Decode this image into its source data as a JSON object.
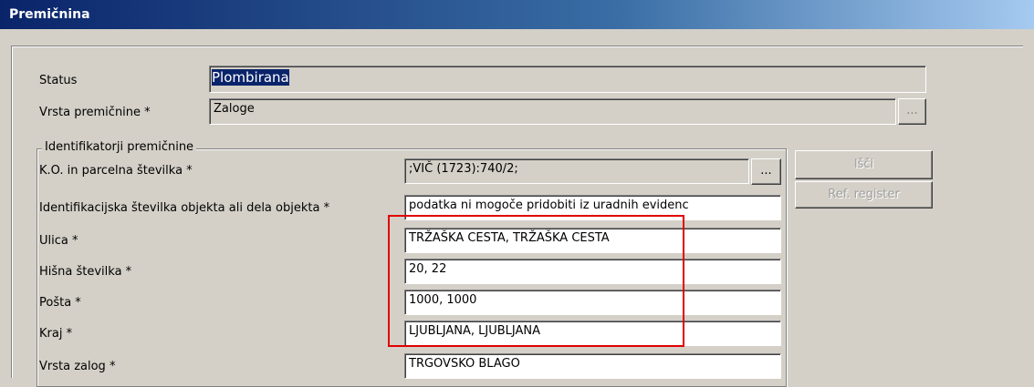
{
  "window": {
    "title": "Premičnina"
  },
  "status": {
    "label": "Status",
    "value": "Plombirana"
  },
  "vrsta": {
    "label": "Vrsta premičnine *",
    "value": "Zaloge",
    "browse": "..."
  },
  "group": {
    "title": "Identifikatorji premičnine",
    "ko": {
      "label": "K.O. in parcelna številka *",
      "value": ";VIČ (1723):740/2;",
      "browse": "..."
    },
    "idobj": {
      "label": "Identifikacijska številka objekta ali dela objekta *",
      "value": "podatka ni mogoče pridobiti iz uradnih evidenc"
    },
    "ulica": {
      "label": "Ulica *",
      "value": "TRŽAŠKA CESTA, TRŽAŠKA CESTA"
    },
    "hisna": {
      "label": "Hišna številka *",
      "value": "20, 22"
    },
    "posta": {
      "label": "Pošta *",
      "value": "1000, 1000"
    },
    "kraj": {
      "label": "Kraj *",
      "value": "LJUBLJANA, LJUBLJANA"
    },
    "zalog": {
      "label": "Vrsta zalog *",
      "value": "TRGOVSKO BLAGO"
    }
  },
  "buttons": {
    "isci": "Išči",
    "ref": "Ref. register"
  },
  "colors": {
    "titlebar": "#0a246a",
    "highlight": "#e00000",
    "face": "#d4d0c8"
  }
}
